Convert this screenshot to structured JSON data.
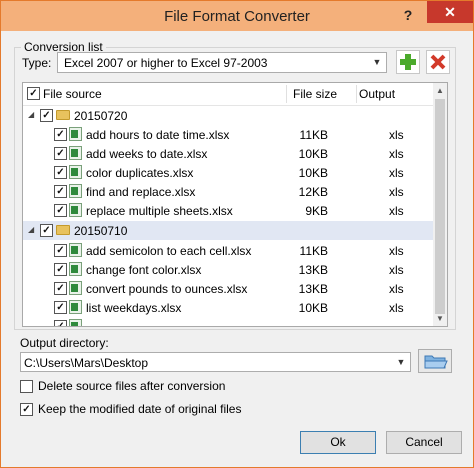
{
  "window": {
    "title": "File Format Converter",
    "help": "?",
    "close": "✕"
  },
  "group": {
    "legend": "Conversion list"
  },
  "type": {
    "label": "Type:",
    "value": "Excel 2007 or higher to Excel 97-2003"
  },
  "list": {
    "headers": {
      "source": "File source",
      "size": "File size",
      "output": "Output"
    },
    "groups": [
      {
        "name": "20150720",
        "checked": true,
        "files": [
          {
            "name": "add hours to date time.xlsx",
            "size": "11KB",
            "output": "xls"
          },
          {
            "name": "add weeks to date.xlsx",
            "size": "10KB",
            "output": "xls"
          },
          {
            "name": "color duplicates.xlsx",
            "size": "10KB",
            "output": "xls"
          },
          {
            "name": "find and replace.xlsx",
            "size": "12KB",
            "output": "xls"
          },
          {
            "name": "replace multiple sheets.xlsx",
            "size": "9KB",
            "output": "xls"
          }
        ]
      },
      {
        "name": "20150710",
        "checked": true,
        "selected": true,
        "files": [
          {
            "name": "add semicolon to each cell.xlsx",
            "size": "11KB",
            "output": "xls"
          },
          {
            "name": "change font color.xlsx",
            "size": "13KB",
            "output": "xls"
          },
          {
            "name": "convert pounds to ounces.xlsx",
            "size": "13KB",
            "output": "xls"
          },
          {
            "name": "list weekdays.xlsx",
            "size": "10KB",
            "output": "xls"
          }
        ]
      }
    ]
  },
  "output_dir": {
    "label": "Output directory:",
    "value": "C:\\Users\\Mars\\Desktop"
  },
  "options": {
    "delete_source": {
      "label": "Delete source files after conversion",
      "checked": false
    },
    "keep_date": {
      "label": "Keep the modified date of original files",
      "checked": true
    }
  },
  "buttons": {
    "ok": "Ok",
    "cancel": "Cancel"
  },
  "colors": {
    "title_bar": "#f4b07b",
    "close": "#c7382c",
    "selected_row": "#e1e7f3",
    "add_green": "#4caa2c",
    "remove_red": "#d23a2a"
  }
}
